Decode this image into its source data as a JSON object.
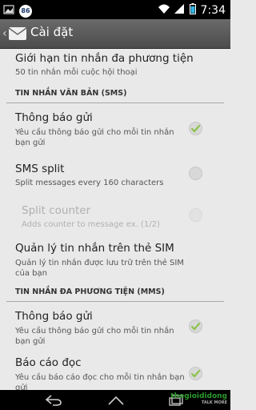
{
  "status_bar": {
    "badge": "86",
    "time": "7:34"
  },
  "action_bar": {
    "title": "Cài đặt"
  },
  "items": {
    "mms_limit": {
      "title": "Giới hạn tin nhắn đa phương tiện",
      "summary": "50 tin nhắn mỗi cuộc hội thoại"
    },
    "sms_header": "TIN NHẮN VĂN BẢN (SMS)",
    "sms_delivery": {
      "title": "Thông báo gửi",
      "summary": "Yêu cầu thông báo gửi cho mỗi tin nhắn bạn gửi",
      "checked": true
    },
    "sms_split": {
      "title": "SMS split",
      "summary": "Split messages every 160 characters",
      "checked": false
    },
    "split_counter": {
      "title": "Split counter",
      "summary": "Adds counter to message ex. (1/2)",
      "checked": false,
      "enabled": false
    },
    "sim_manage": {
      "title": "Quản lý tin nhắn trên thẻ SIM",
      "summary": "Quản lý tin nhắn được lưu trữ trên thẻ SIM của bạn"
    },
    "mms_header": "TIN NHẮN ĐA PHƯƠNG TIỆN (MMS)",
    "mms_delivery": {
      "title": "Thông báo gửi",
      "summary": "Yêu cầu thông báo gửi cho mỗi tin nhắn bạn gửi",
      "checked": true
    },
    "read_report": {
      "title": "Báo cáo đọc",
      "summary": "Yêu cầu báo cáo đọc cho mỗi tin nhắn bạn gửi",
      "checked": true
    }
  },
  "watermark": {
    "name": "thegioididong",
    "sub": "TALK MORE"
  },
  "colors": {
    "check_green": "#8bc34a",
    "background": "#e9e9e9"
  }
}
